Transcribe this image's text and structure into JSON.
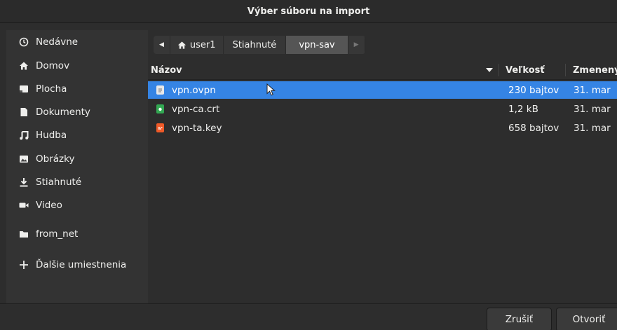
{
  "window": {
    "title": "Výber súboru na import"
  },
  "sidebar": {
    "items": [
      {
        "label": "Nedávne",
        "icon": "clock-icon"
      },
      {
        "label": "Domov",
        "icon": "home-icon"
      },
      {
        "label": "Plocha",
        "icon": "desktop-icon"
      },
      {
        "label": "Dokumenty",
        "icon": "document-icon"
      },
      {
        "label": "Hudba",
        "icon": "music-icon"
      },
      {
        "label": "Obrázky",
        "icon": "pictures-icon"
      },
      {
        "label": "Stiahnuté",
        "icon": "download-icon"
      },
      {
        "label": "Video",
        "icon": "video-icon"
      },
      {
        "label": "from_net",
        "icon": "folder-icon"
      },
      {
        "label": "Ďalšie umiestnenia",
        "icon": "plus-icon"
      }
    ]
  },
  "pathbar": {
    "segments": [
      {
        "label": "user1",
        "icon": "home-icon"
      },
      {
        "label": "Stiahnuté"
      },
      {
        "label": "vpn-sav",
        "active": true
      }
    ]
  },
  "columns": {
    "name": "Názov",
    "size": "Veľkosť",
    "modified": "Zmenený"
  },
  "files": [
    {
      "name": "vpn.ovpn",
      "size": "230 bajtov",
      "modified": "31. mar",
      "icon": "text-file-icon",
      "icon_color": "#e8e8e8",
      "selected": true
    },
    {
      "name": "vpn-ca.crt",
      "size": "1,2 kB",
      "modified": "31. mar",
      "icon": "certificate-file-icon",
      "icon_color": "#33a853",
      "selected": false
    },
    {
      "name": "vpn-ta.key",
      "size": "658 bajtov",
      "modified": "31. mar",
      "icon": "key-file-icon",
      "icon_color": "#f05a28",
      "selected": false
    }
  ],
  "buttons": {
    "cancel": "Zrušiť",
    "open": "Otvoriť"
  },
  "colors": {
    "accent": "#3584e4",
    "background": "#2d2d2d",
    "sidebar": "#333333"
  }
}
